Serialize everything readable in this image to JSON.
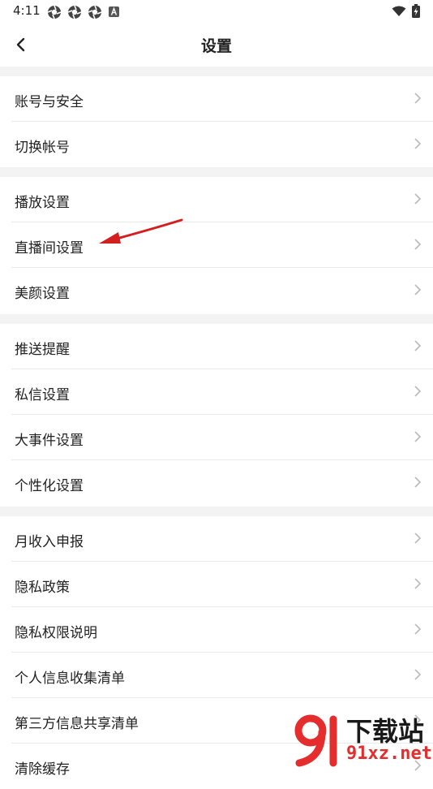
{
  "status_bar": {
    "time": "4:11",
    "left_icons": [
      "aperture-icon",
      "aperture-icon",
      "aperture-icon",
      "a-icon"
    ],
    "right_icons": [
      "wifi-icon",
      "battery-icon"
    ]
  },
  "header": {
    "title": "设置",
    "back_icon": "chevron-left-icon"
  },
  "groups": [
    {
      "items": [
        {
          "label": "账号与安全"
        },
        {
          "label": "切换帐号"
        }
      ]
    },
    {
      "items": [
        {
          "label": "播放设置"
        },
        {
          "label": "直播间设置"
        },
        {
          "label": "美颜设置"
        }
      ]
    },
    {
      "items": [
        {
          "label": "推送提醒"
        },
        {
          "label": "私信设置"
        },
        {
          "label": "大事件设置"
        },
        {
          "label": "个性化设置"
        }
      ]
    },
    {
      "items": [
        {
          "label": "月收入申报"
        },
        {
          "label": "隐私政策"
        },
        {
          "label": "隐私权限说明"
        },
        {
          "label": "个人信息收集清单"
        },
        {
          "label": "第三方信息共享清单"
        },
        {
          "label": "清除缓存"
        }
      ]
    }
  ],
  "annotation": {
    "icon": "red-arrow-icon",
    "color": "#d41f1f"
  },
  "watermark": {
    "text": "下载站",
    "sub": "91xz.net",
    "logo_color": "#e52d2d"
  },
  "colors": {
    "background": "#ffffff",
    "separator": "#f3f3f3",
    "chevron": "#bdbdbd"
  }
}
